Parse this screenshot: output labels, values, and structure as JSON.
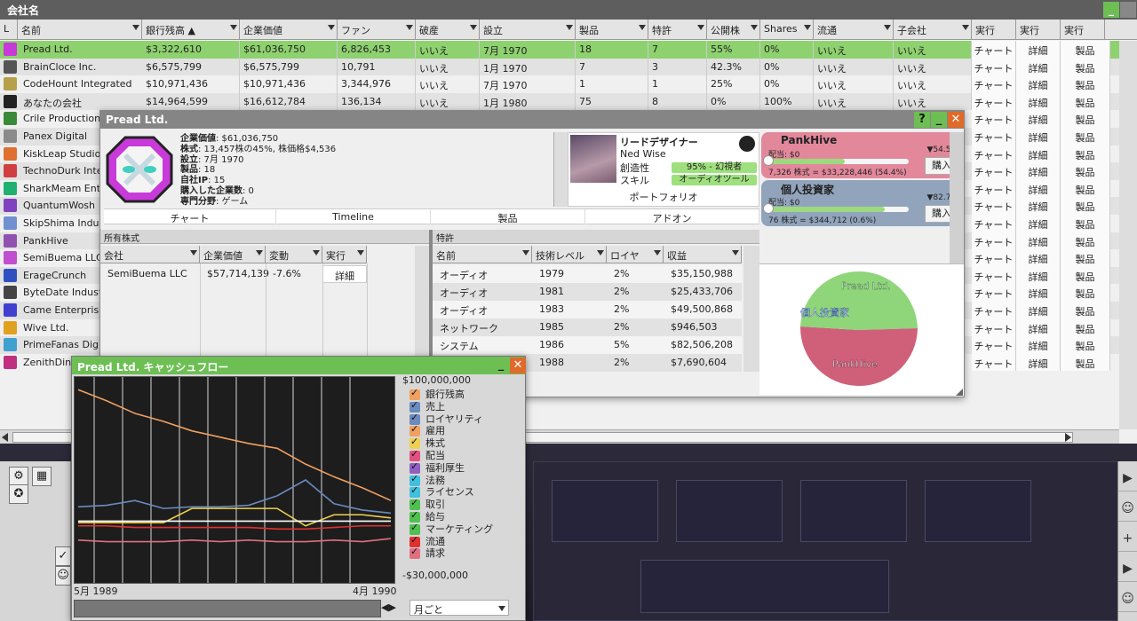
{
  "main": {
    "title": "会社名",
    "headers": [
      "L",
      "名前",
      "銀行残高 ▲",
      "企業価値",
      "ファン",
      "破産",
      "設立",
      "製品",
      "特許",
      "公開株",
      "Shares",
      "流通",
      "子会社",
      "実行",
      "実行",
      "実行"
    ],
    "rows": [
      {
        "name": "Pread Ltd.",
        "bank": "$3,322,610",
        "value": "$61,036,750",
        "fans": "6,826,453",
        "bankrupt": "いいえ",
        "founded": "7月 1970",
        "products": "18",
        "patents": "7",
        "public": "55%",
        "shares": "0%",
        "circ": "いいえ",
        "sub": "いいえ",
        "color": "#c83ad9"
      },
      {
        "name": "BrainCloce Inc.",
        "bank": "$6,575,799",
        "value": "$6,575,799",
        "fans": "10,791",
        "bankrupt": "いいえ",
        "founded": "1月 1970",
        "products": "7",
        "patents": "3",
        "public": "42.3%",
        "shares": "0%",
        "circ": "いいえ",
        "sub": "いいえ",
        "color": "#555"
      },
      {
        "name": "CodeHount Integrated",
        "bank": "$10,971,436",
        "value": "$10,971,436",
        "fans": "3,344,976",
        "bankrupt": "いいえ",
        "founded": "7月 1970",
        "products": "1",
        "patents": "1",
        "public": "25%",
        "shares": "0%",
        "circ": "いいえ",
        "sub": "いいえ",
        "color": "#b6a04a"
      },
      {
        "name": "あなたの会社",
        "bank": "$14,964,599",
        "value": "$16,612,784",
        "fans": "136,134",
        "bankrupt": "いいえ",
        "founded": "1月 1980",
        "products": "75",
        "patents": "8",
        "public": "0%",
        "shares": "100%",
        "circ": "いいえ",
        "sub": "いいえ",
        "color": "#222"
      },
      {
        "name": "Crile Production",
        "color": "#3a8a3a"
      },
      {
        "name": "Panex Digital",
        "color": "#8a8a8a"
      },
      {
        "name": "KiskLeap Studio",
        "color": "#e07030"
      },
      {
        "name": "TechnoDurk Inte",
        "color": "#d04040"
      },
      {
        "name": "SharkMeam Ent",
        "color": "#20b070"
      },
      {
        "name": "QuantumWosh",
        "color": "#8040c0"
      },
      {
        "name": "SkipShima Indus",
        "color": "#7090d0"
      },
      {
        "name": "PankHive",
        "color": "#9050b0"
      },
      {
        "name": "SemiBuema LLC",
        "color": "#c050d0"
      },
      {
        "name": "ErageCrunch",
        "color": "#3050c0"
      },
      {
        "name": "ByteDate Indust",
        "color": "#444"
      },
      {
        "name": "Came Enterprise",
        "color": "#4040d0"
      },
      {
        "name": "Wive Ltd.",
        "color": "#e0a020"
      },
      {
        "name": "PrimeFanas Digi",
        "color": "#40a0d0"
      },
      {
        "name": "ZenithDino",
        "color": "#c03080"
      }
    ],
    "act_chart": "チャート",
    "act_detail": "詳細",
    "act_products": "製品"
  },
  "detail": {
    "title": "Pread Ltd.",
    "help": "?",
    "info": [
      {
        "k": "企業価値",
        "v": ": $61,036,750"
      },
      {
        "k": "株式",
        "v": ": 13,457株の45%, 株価格$4,536"
      },
      {
        "k": "設立",
        "v": ": 7月 1970"
      },
      {
        "k": "製品",
        "v": ": 18"
      },
      {
        "k": "自社IP",
        "v": ": 15"
      },
      {
        "k": "購入した企業数",
        "v": ": 0"
      },
      {
        "k": "専門分野",
        "v": ": ゲーム"
      }
    ],
    "designer": {
      "role": "リードデザイナー",
      "name": "Ned Wise",
      "l1": "創造性",
      "v1": "95% - 幻視者",
      "l2": "スキル",
      "v2": "オーディオツール",
      "portfolio": "ポートフォリオ"
    },
    "tabs": [
      "チャート",
      "Timeline",
      "製品",
      "アドオン"
    ],
    "holders": [
      {
        "name": "PankHive",
        "pct": "▼54.5%",
        "div": "配当: $0",
        "shares": "7,326 株式 = $33,228,446 (54.4%)",
        "buy": "購入",
        "level": 0.545,
        "bg": "#e2889a"
      },
      {
        "name": "個人投資家",
        "pct": "▼82.7%",
        "div": "配当: $0",
        "shares": "76 株式 = $344,712 (0.6%)",
        "buy": "購入",
        "level": 0.827,
        "bg": "#92a4bc"
      }
    ],
    "pie": {
      "labels": [
        "Pread Ltd.",
        "個人投資家",
        "PankHive"
      ],
      "colors": [
        "#8fd57a",
        "#5aa0e0",
        "#d0607a"
      ]
    },
    "owned": {
      "title": "所有株式",
      "headers": [
        "会社",
        "企業価値",
        "変動",
        "実行"
      ],
      "rows": [
        {
          "c": "SemiBuema LLC",
          "v": "$57,714,139",
          "ch": "-7.6%",
          "a": "詳細"
        }
      ]
    },
    "patents": {
      "title": "特許",
      "headers": [
        "名前",
        "技術レベル",
        "ロイヤ",
        "収益"
      ],
      "rows": [
        {
          "n": "オーディオ",
          "y": "1979",
          "r": "2%",
          "v": "$35,150,988"
        },
        {
          "n": "オーディオ",
          "y": "1981",
          "r": "2%",
          "v": "$25,433,706"
        },
        {
          "n": "オーディオ",
          "y": "1983",
          "r": "2%",
          "v": "$49,500,868"
        },
        {
          "n": "ネットワーク",
          "y": "1985",
          "r": "2%",
          "v": "$946,503"
        },
        {
          "n": "システム",
          "y": "1986",
          "r": "5%",
          "v": "$82,506,208"
        },
        {
          "n": "",
          "y": "1988",
          "r": "2%",
          "v": "$7,690,604"
        }
      ]
    }
  },
  "cash": {
    "title": "Pread Ltd. キャッシュフロー",
    "ymax": "$100,000,000",
    "ymin": "-$30,000,000",
    "x_start": "5月 1989",
    "x_end": "4月 1990",
    "period": "月ごと",
    "legend": [
      {
        "name": "銀行残高",
        "color": "#f0a060"
      },
      {
        "name": "売上",
        "color": "#6a8ac0"
      },
      {
        "name": "ロイヤリティ",
        "color": "#6a8ac0"
      },
      {
        "name": "雇用",
        "color": "#f0a060"
      },
      {
        "name": "株式",
        "color": "#f0d050"
      },
      {
        "name": "配当",
        "color": "#e05080"
      },
      {
        "name": "福利厚生",
        "color": "#9060c0"
      },
      {
        "name": "法務",
        "color": "#40c0e0"
      },
      {
        "name": "ライセンス",
        "color": "#40c0e0"
      },
      {
        "name": "取引",
        "color": "#50c050"
      },
      {
        "name": "給与",
        "color": "#50c050"
      },
      {
        "name": "マーケティング",
        "color": "#50c050"
      },
      {
        "name": "流通",
        "color": "#e03030"
      },
      {
        "name": "請求",
        "color": "#e07080"
      }
    ],
    "chart_data": {
      "type": "line",
      "x": [
        "5月 1989",
        "6月 1989",
        "7月 1989",
        "8月 1989",
        "9月 1989",
        "10月 1989",
        "11月 1989",
        "12月 1989",
        "1月 1990",
        "2月 1990",
        "3月 1990",
        "4月 1990"
      ],
      "ylim": [
        -30000000,
        100000000
      ],
      "series": [
        {
          "name": "銀行残高",
          "color": "#f0a060",
          "values": [
            92000000,
            85000000,
            77000000,
            72000000,
            66000000,
            62000000,
            58000000,
            55000000,
            45000000,
            37000000,
            30000000,
            22000000
          ]
        },
        {
          "name": "売上",
          "color": "#6a8ac0",
          "values": [
            18000000,
            19000000,
            22000000,
            17000000,
            18000000,
            18000000,
            19000000,
            25000000,
            35000000,
            20000000,
            16000000,
            14000000
          ]
        },
        {
          "name": "株式",
          "color": "#f0d050",
          "values": [
            8000000,
            8000000,
            8000000,
            8000000,
            17000000,
            17000000,
            17000000,
            17000000,
            6000000,
            13000000,
            13000000,
            11000000
          ]
        },
        {
          "name": "ライセンス",
          "color": "#ffffff",
          "values": [
            9000000,
            9000000,
            9000000,
            9000000,
            9000000,
            9000000,
            9000000,
            9000000,
            9000000,
            9000000,
            9000000,
            9000000
          ]
        },
        {
          "name": "流通",
          "color": "#e03030",
          "values": [
            6000000,
            6000000,
            5000000,
            5000000,
            5000000,
            5000000,
            5000000,
            4000000,
            4000000,
            5000000,
            6000000,
            6000000
          ]
        },
        {
          "name": "請求",
          "color": "#e07080",
          "values": [
            -3000000,
            -4000000,
            -4000000,
            -4000000,
            -3000000,
            -4000000,
            -3000000,
            -4000000,
            -4000000,
            -3000000,
            -4000000,
            -2000000
          ]
        }
      ]
    }
  }
}
